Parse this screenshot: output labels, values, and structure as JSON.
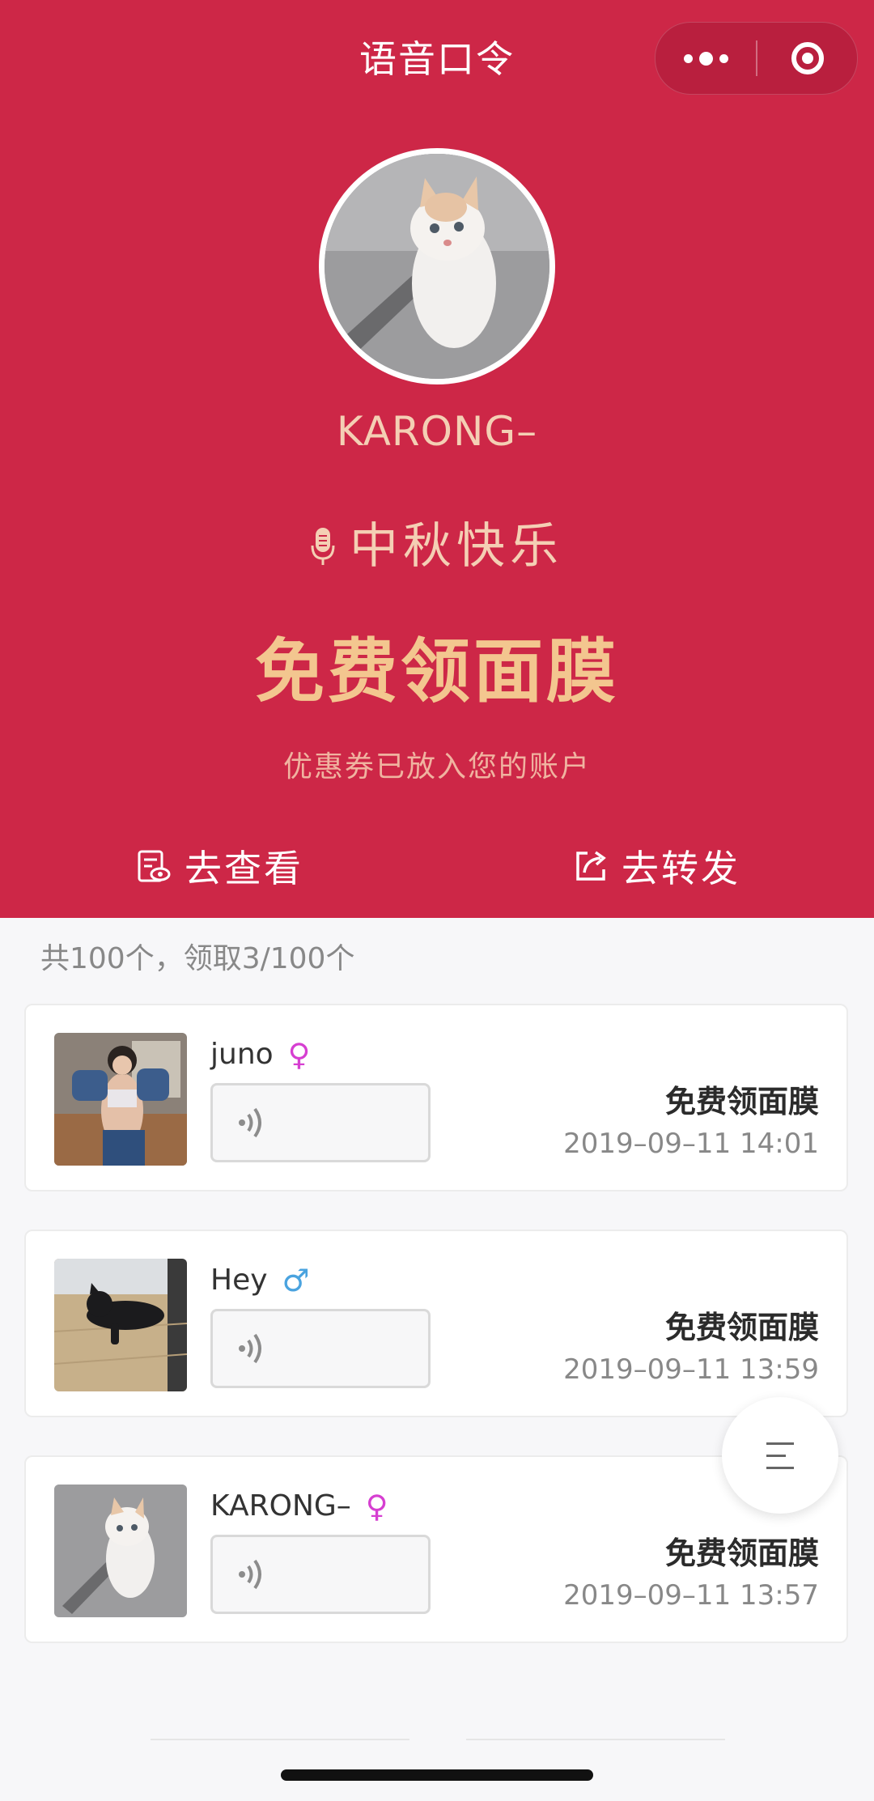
{
  "navbar": {
    "title": "语音口令",
    "more_icon": "more-dots-icon",
    "close_icon": "target-circle-icon"
  },
  "profile": {
    "avatar_icon": "cat-photo",
    "username": "KARONG–"
  },
  "voice_command": {
    "icon": "microphone-icon",
    "text": "中秋快乐"
  },
  "reward": {
    "title": "免费领面膜",
    "note": "优惠券已放入您的账户"
  },
  "actions": {
    "view_label": "去查看",
    "view_icon": "document-eye-icon",
    "share_label": "去转发",
    "share_icon": "share-out-icon"
  },
  "summary": "共100个，领取3/100个",
  "records": [
    {
      "name": "juno",
      "gender": "♀",
      "gender_type": "female",
      "avatar": "woman-photo",
      "prize": "免费领面膜",
      "time": "2019–09–11 14:01"
    },
    {
      "name": "Hey",
      "gender": "♂",
      "gender_type": "male",
      "avatar": "black-cat-photo",
      "prize": "免费领面膜",
      "time": "2019–09–11 13:59"
    },
    {
      "name": "KARONG–",
      "gender": "♀",
      "gender_type": "female",
      "avatar": "cat-photo",
      "prize": "免费领面膜",
      "time": "2019–09–11 13:57"
    }
  ],
  "fab_icon": "menu-lines-icon",
  "colors": {
    "header_red": "#cd2747",
    "peach_text": "#f4cfb4",
    "gold_title": "#f3c68f",
    "female": "#d63fd1",
    "male": "#4aa3df"
  }
}
